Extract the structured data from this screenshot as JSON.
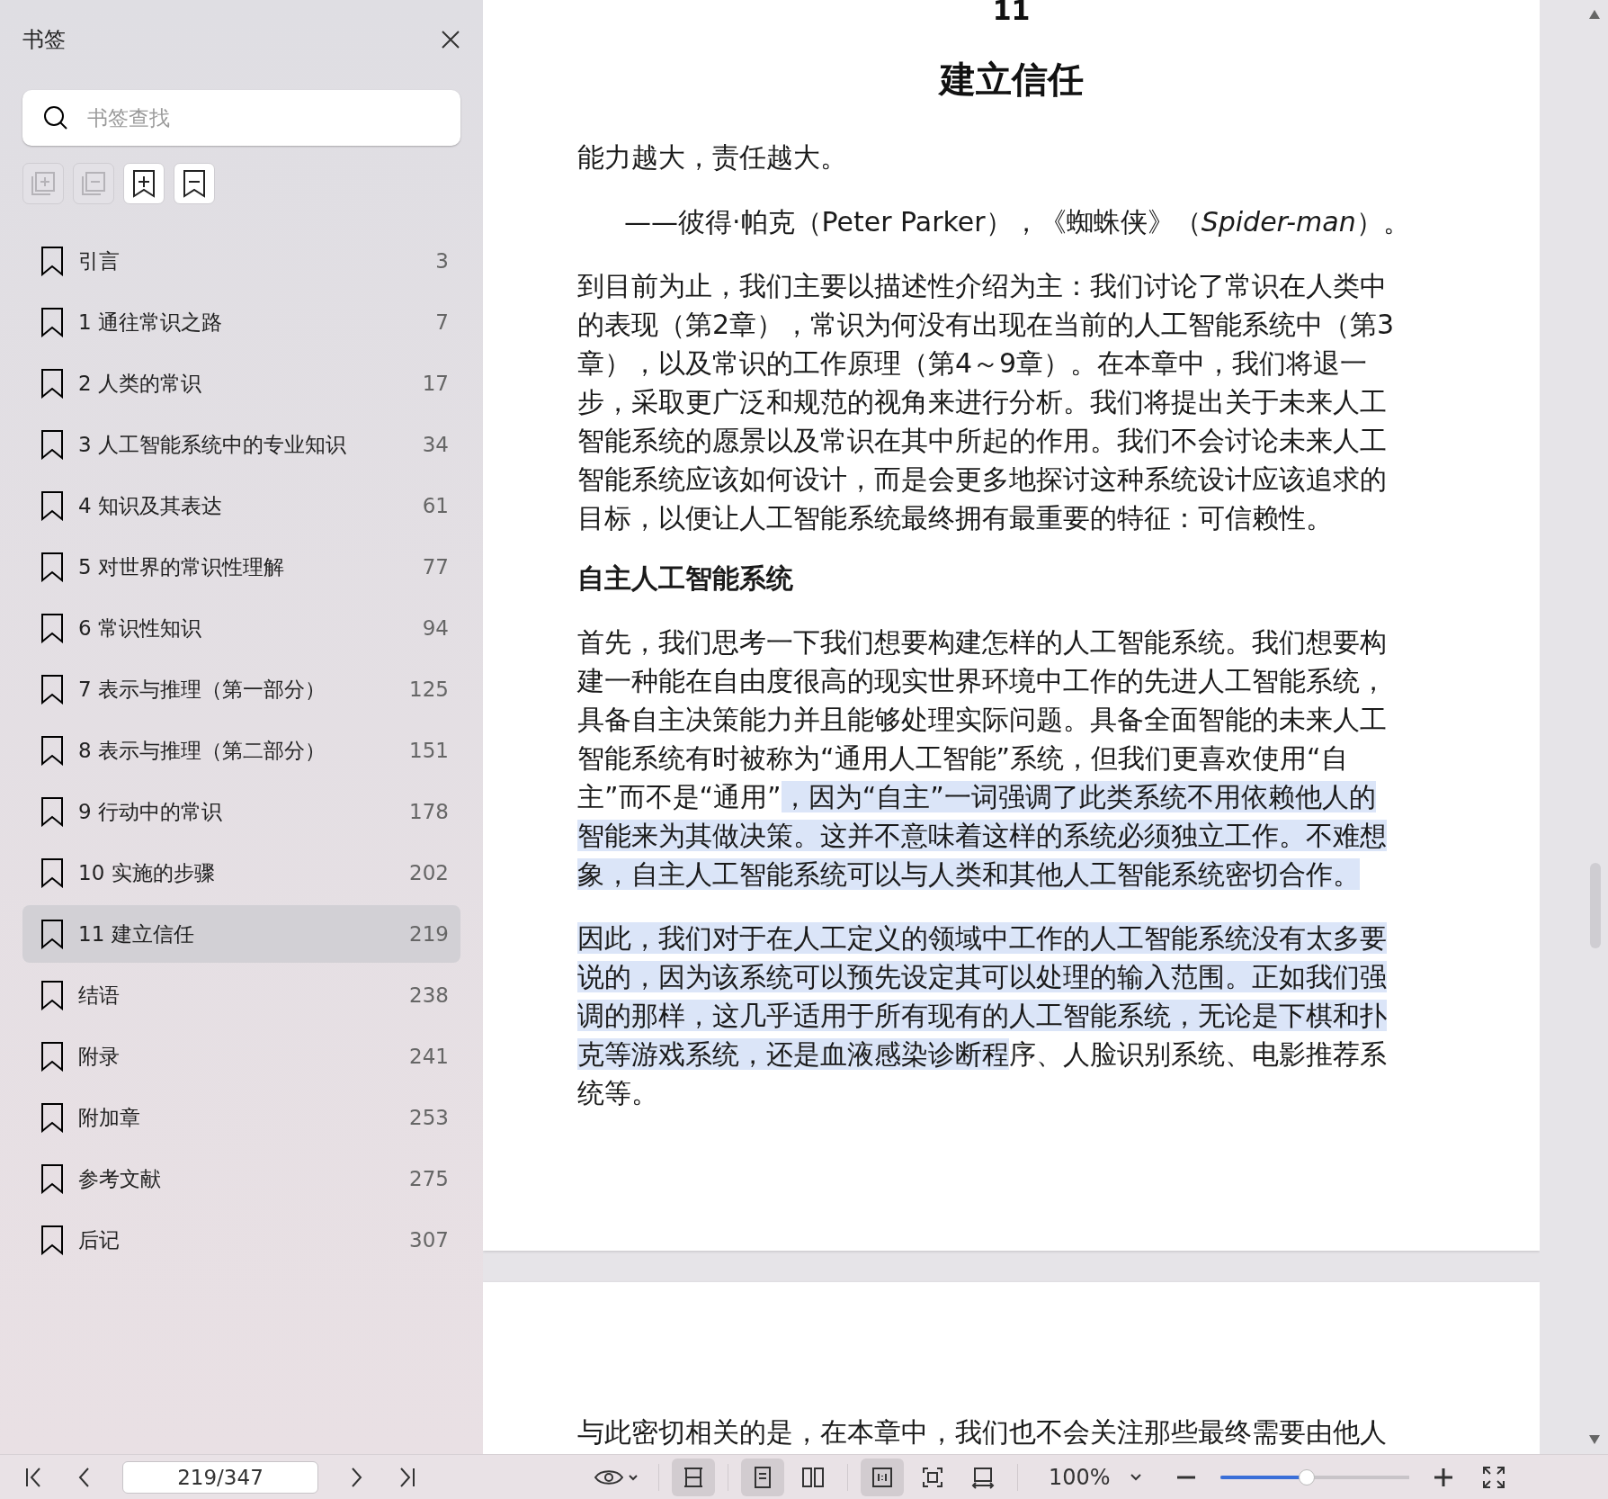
{
  "sidebar": {
    "title": "书签",
    "search": {
      "placeholder": "书签查找"
    },
    "tool_buttons": [
      {
        "disabled": true
      },
      {
        "disabled": true
      },
      {
        "disabled": false
      },
      {
        "disabled": false
      }
    ],
    "items": [
      {
        "label": "引言",
        "page": "3",
        "selected": false
      },
      {
        "label": "1 通往常识之路",
        "page": "7",
        "selected": false
      },
      {
        "label": "2 人类的常识",
        "page": "17",
        "selected": false
      },
      {
        "label": "3 人工智能系统中的专业知识",
        "page": "34",
        "selected": false
      },
      {
        "label": "4 知识及其表达",
        "page": "61",
        "selected": false
      },
      {
        "label": "5 对世界的常识性理解",
        "page": "77",
        "selected": false
      },
      {
        "label": "6 常识性知识",
        "page": "94",
        "selected": false
      },
      {
        "label": "7 表示与推理（第一部分）",
        "page": "125",
        "selected": false
      },
      {
        "label": "8 表示与推理（第二部分）",
        "page": "151",
        "selected": false
      },
      {
        "label": "9 行动中的常识",
        "page": "178",
        "selected": false
      },
      {
        "label": "10 实施的步骤",
        "page": "202",
        "selected": false
      },
      {
        "label": "11 建立信任",
        "page": "219",
        "selected": true
      },
      {
        "label": "结语",
        "page": "238",
        "selected": false
      },
      {
        "label": "附录",
        "page": "241",
        "selected": false
      },
      {
        "label": "附加章",
        "page": "253",
        "selected": false
      },
      {
        "label": "参考文献",
        "page": "275",
        "selected": false
      },
      {
        "label": "后记",
        "page": "307",
        "selected": false
      }
    ]
  },
  "document": {
    "chapter_number": "11",
    "chapter_title": "建立信任",
    "epigraph": "能力越大，责任越大。",
    "attribution": "——彼得·帕克（Peter Parker），《蜘蛛侠》（*Spider-man*）。",
    "blocks": [
      {
        "kind": "paragraph",
        "segments": [
          {
            "text": "到目前为止，我们主要以描述性介绍为主：我们讨论了常识在人类中的表现（第2章），常识为何没有出现在当前的人工智能系统中（第3章），以及常识的工作原理（第4～9章）。在本章中，我们将退一步，采取更广泛和规范的视角来进行分析。我们将提出关于未来人工智能系统的愿景以及常识在其中所起的作用。我们不会讨论未来人工智能系统应该如何设计，而是会更多地探讨这种系统设计应该追求的目标，以便让人工智能系统最终拥有最重要的特征：可信赖性。",
            "highlighted": false
          }
        ]
      },
      {
        "kind": "heading",
        "segments": [
          {
            "text": "自主人工智能系统",
            "highlighted": false
          }
        ]
      },
      {
        "kind": "paragraph",
        "segments": [
          {
            "text": "首先，我们思考一下我们想要构建怎样的人工智能系统。我们想要构建一种能在自由度很高的现实世界环境中工作的先进人工智能系统，具备自主决策能力并且能够处理实际问题。具备全面智能的未来人工智能系统有时被称为“通用人工智能”系统，但我们更喜欢使用“自主”而不是“通用”",
            "highlighted": false
          },
          {
            "text": "，因为“自主”一词强调了此类系统不用依赖他人的智能来为其做决策。这并不意味着这样的系统必须独立工作。不难想象，自主人工智能系统可以与人类和其他人工智能系统密切合作。",
            "highlighted": true
          }
        ]
      },
      {
        "kind": "paragraph",
        "segments": [
          {
            "text": "因此，我们对于在人工定义的领域中工作的人工智能系统没有太多要说的，因为该系统可以预先设定其可以处理的输入范围。正如我们强调的那样，这几乎适用于所有现有的人工智能系统，无论是下棋和扑克等游戏系统，还是血液感染诊断程",
            "highlighted": true
          },
          {
            "text": "序、人脸识别系统、电影推荐系统等。",
            "highlighted": false
          }
        ]
      }
    ],
    "next_page_text": "与此密切相关的是，在本章中，我们也不会关注那些最终需要由他人"
  },
  "toolbar": {
    "page_field": "219/347",
    "view_buttons": [
      {
        "selected": true
      },
      {
        "selected": true
      },
      {
        "selected": false
      },
      {
        "selected": true
      },
      {
        "selected": false
      },
      {
        "selected": false
      }
    ],
    "zoom": "100%",
    "zoom_slider": {
      "level": 0.46
    }
  }
}
